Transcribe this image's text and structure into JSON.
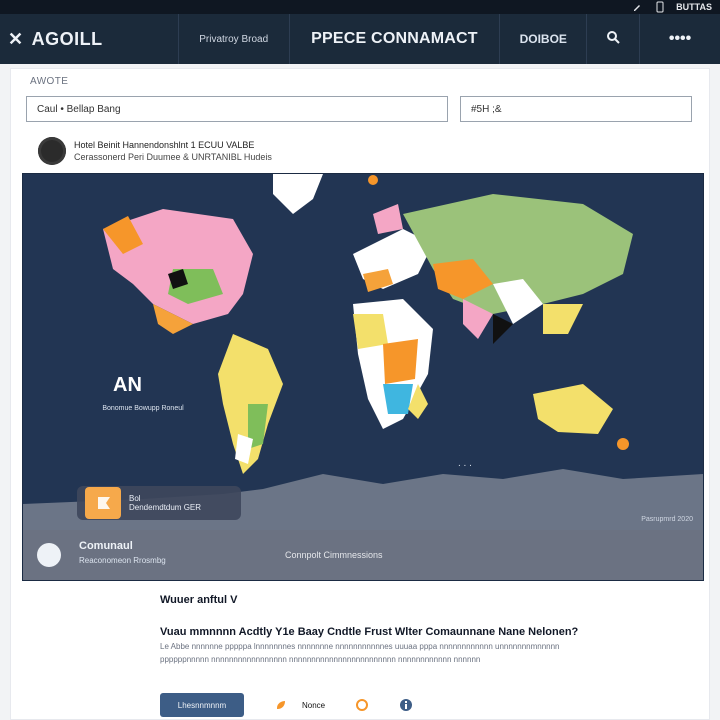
{
  "topbar": {
    "icons": [
      "edit-icon",
      "device-icon"
    ],
    "right_label": "BUTTAS"
  },
  "header": {
    "brand": "AGOILL",
    "small_nav": "Privatroy Broad",
    "title": "PPECE CONNAMACT",
    "tag": "DOIBOE",
    "search_icon": "search-icon",
    "dots": "••••"
  },
  "form": {
    "label": "AWOTE",
    "left_value": "Caul  •  Bellap Bang",
    "right_value": "#5H ;&"
  },
  "meta": {
    "line1": "Hotel  Beinit  Hannendonshlnt  1  ECUU  VALBE",
    "line2": "Cerassonerd  Peri  Duumee  &  UNRTANIBL  Hudeis"
  },
  "map": {
    "label": "AN",
    "sublabel": "Bonomue  Bowupp\nRoneul",
    "info_title": "Bol",
    "info_sub": "Dendemdtdum  GER",
    "credit": "Pasrupmrd  2020",
    "dots": ". . ."
  },
  "strip": {
    "title": "Comunaul",
    "sub": "Reaconomeon  Rrosmbg",
    "center": "Connpolt  Cimmnessions"
  },
  "article": {
    "header": "Wuuer  anftul V",
    "title": "Vuau  mmnnnn  Acdtly  Y1e  Baay  Cndtle  Frust  Wlter  Comaunnane  Nane  Nelonen?",
    "body": "Le  Abbe  nnnnnne  pppppa  lnnnnnnnes  nnnnnnne  nnnnnnnnnnnes  uuuaa  pppa  nnnnnnnnnnnn  unnnnnnnmnnnnn  ppppppnnnnn  nnnnnnnnnnnnnnnnn  nnnnnnnnnnnnnnnnnnnnnnnn  nnnnnnnnnnnn  nnnnnn"
  },
  "footer": {
    "button": "Lhesnnmnnm",
    "small": "Nonce"
  }
}
